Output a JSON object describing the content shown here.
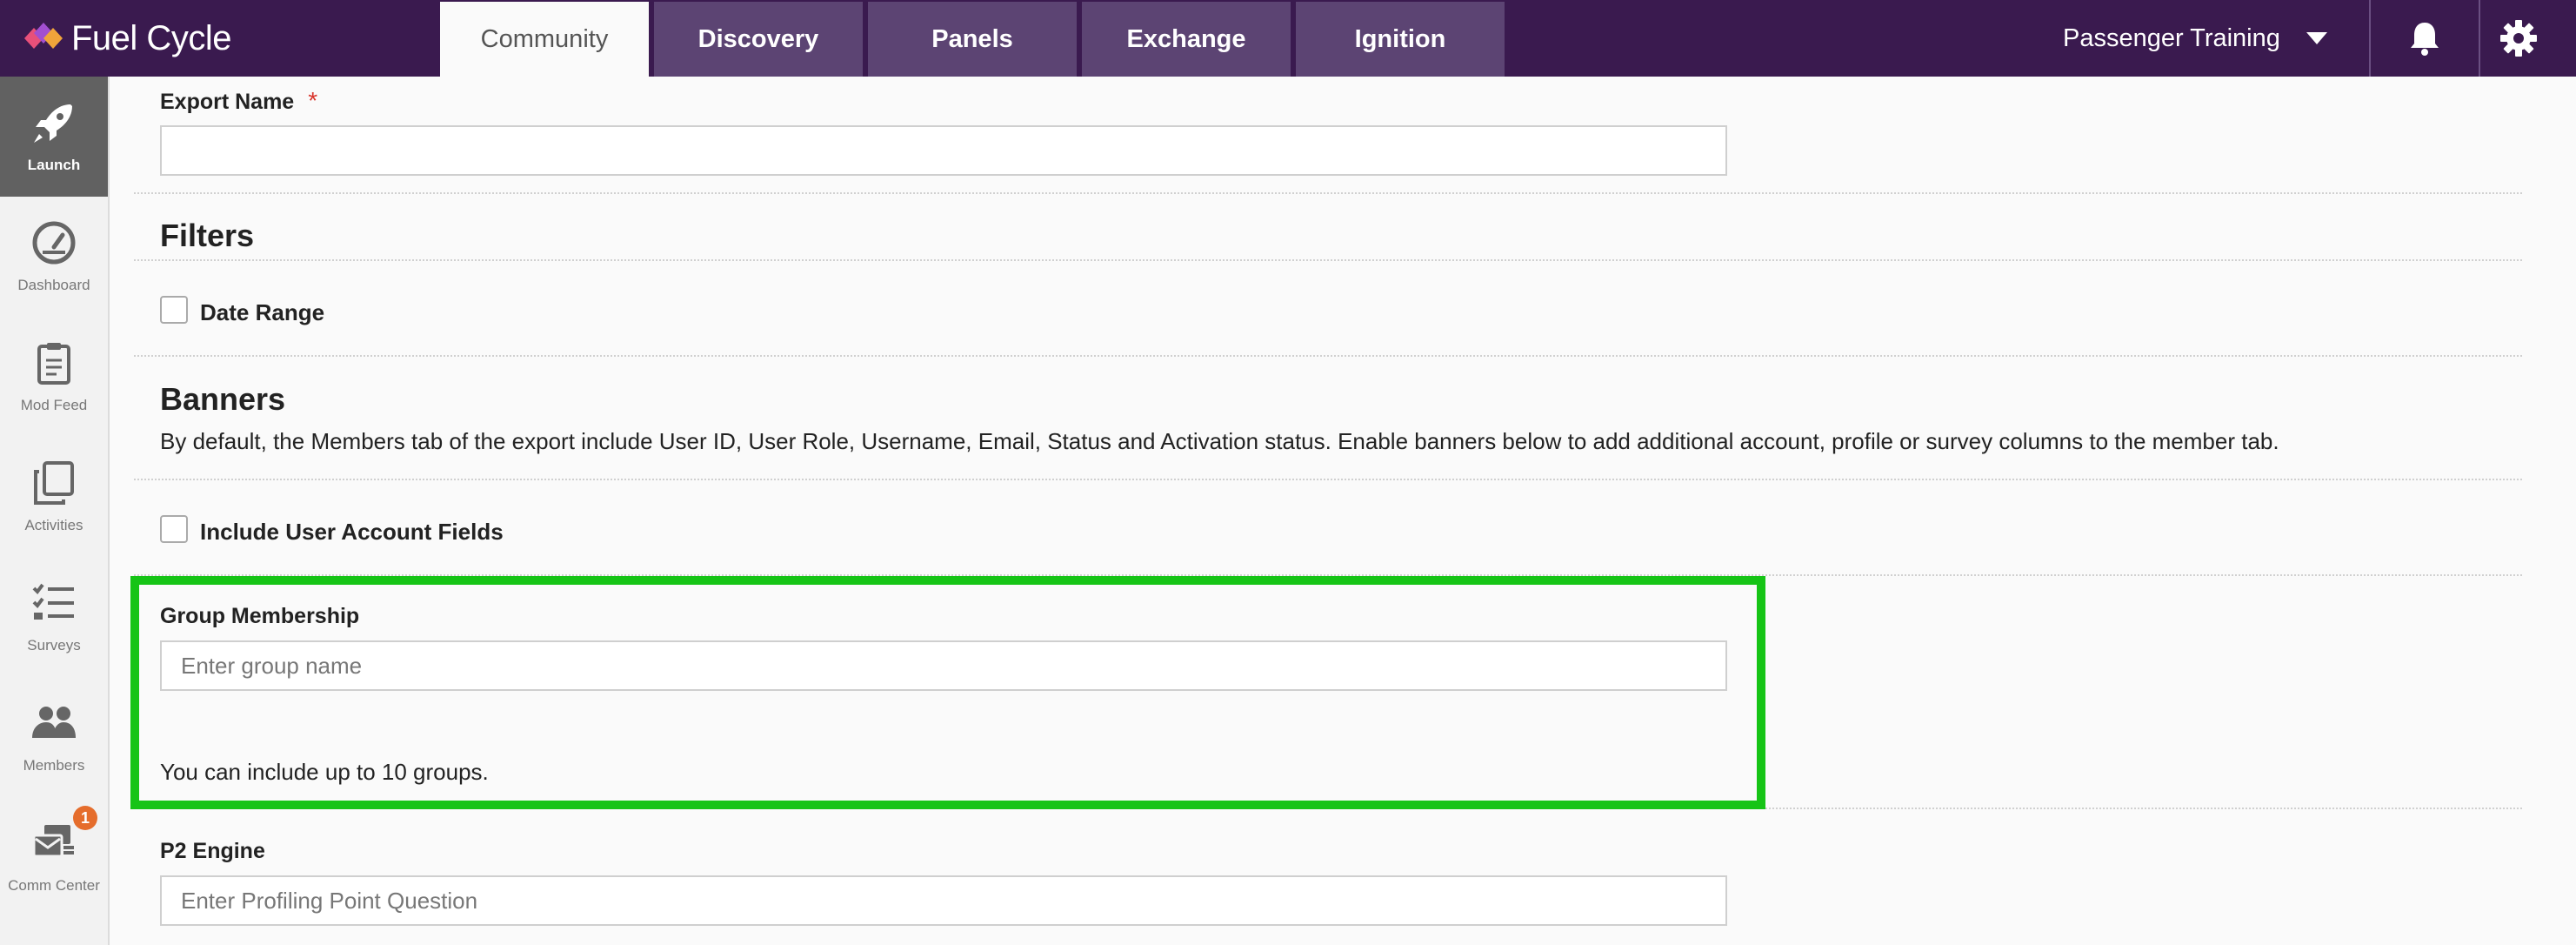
{
  "header": {
    "logo_text": "Fuel Cycle",
    "tabs": [
      {
        "label": "Community",
        "active": true
      },
      {
        "label": "Discovery",
        "active": false
      },
      {
        "label": "Panels",
        "active": false
      },
      {
        "label": "Exchange",
        "active": false
      },
      {
        "label": "Ignition",
        "active": false
      }
    ],
    "project_name": "Passenger Training",
    "icons": [
      "bell-icon",
      "gear-icon"
    ]
  },
  "sidebar": {
    "items": [
      {
        "label": "Launch",
        "icon": "rocket-icon",
        "active": true
      },
      {
        "label": "Dashboard",
        "icon": "gauge-icon"
      },
      {
        "label": "Mod Feed",
        "icon": "clipboard-icon"
      },
      {
        "label": "Activities",
        "icon": "copy-icon"
      },
      {
        "label": "Surveys",
        "icon": "checklist-icon"
      },
      {
        "label": "Members",
        "icon": "users-icon"
      },
      {
        "label": "Comm Center",
        "icon": "mail-stack-icon",
        "badge": "1"
      }
    ]
  },
  "form": {
    "export_name_label": "Export Name",
    "export_name_required": "*",
    "export_name_value": "",
    "filters_title": "Filters",
    "date_range_label": "Date Range",
    "banners_title": "Banners",
    "banners_description": "By default, the Members tab of the export include User ID, User Role, Username, Email, Status and Activation status. Enable banners below to add additional account, profile or survey columns to the member tab.",
    "include_account_fields_label": "Include User Account Fields",
    "group_membership_label": "Group Membership",
    "group_membership_placeholder": "Enter group name",
    "group_limit_note": "You can include up to 10 groups.",
    "p2_engine_label": "P2 Engine",
    "p2_engine_placeholder": "Enter Profiling Point Question"
  },
  "colors": {
    "topbar": "#3a1a4f",
    "tab": "#5c4473",
    "highlight": "#16c416",
    "badge": "#e56d2c",
    "required": "#d9342b"
  }
}
